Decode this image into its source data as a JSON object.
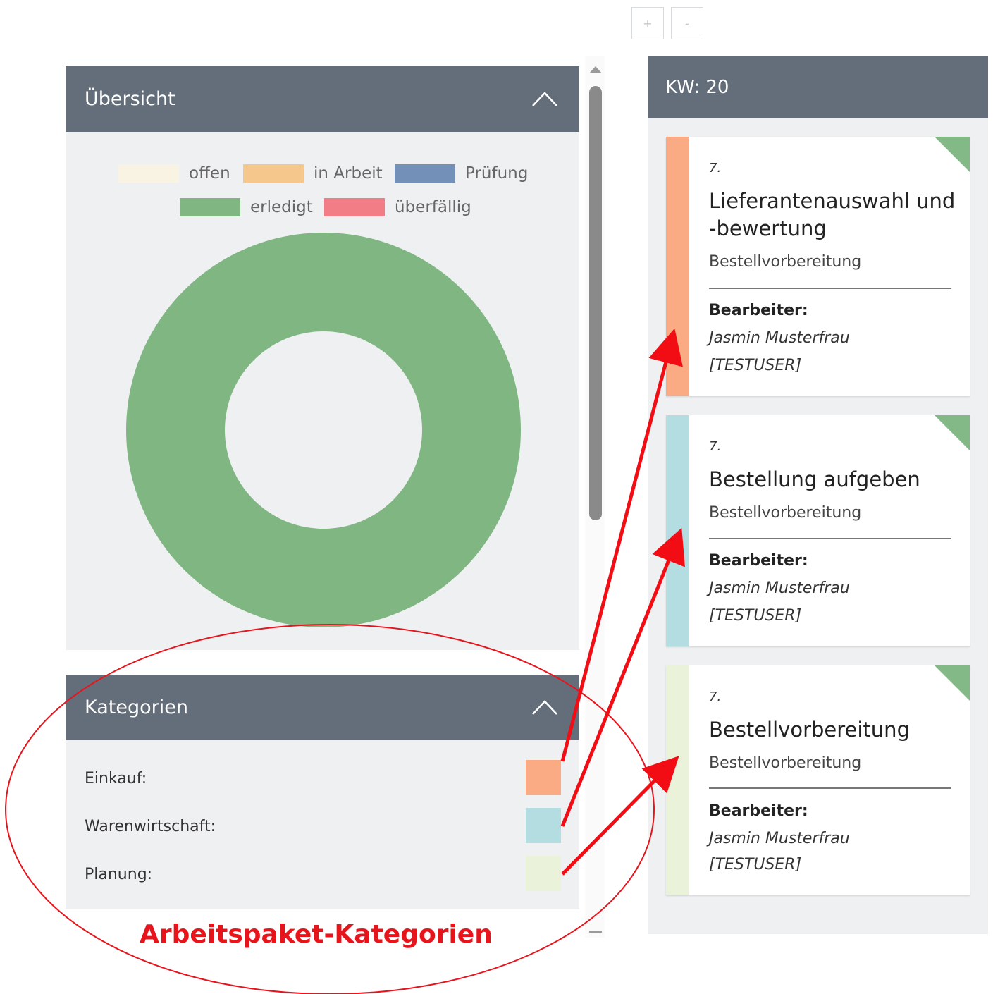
{
  "toolbar": {
    "zoom_in": "+",
    "zoom_out": "-"
  },
  "overview": {
    "title": "Übersicht",
    "legend": [
      {
        "label": "offen",
        "color": "#f8f3e2"
      },
      {
        "label": "in Arbeit",
        "color": "#f6c78d"
      },
      {
        "label": "Prüfung",
        "color": "#7390b8"
      },
      {
        "label": "erledigt",
        "color": "#7fb682"
      },
      {
        "label": "überfällig",
        "color": "#f27d86"
      }
    ],
    "chart_data": {
      "type": "pie",
      "donut": true,
      "categories": [
        "offen",
        "in Arbeit",
        "Prüfung",
        "erledigt",
        "überfällig"
      ],
      "values": [
        0,
        0,
        0,
        100,
        0
      ],
      "colors": [
        "#f8f3e2",
        "#f6c78d",
        "#7390b8",
        "#7fb682",
        "#f27d86"
      ],
      "legend_position": "top"
    }
  },
  "categories": {
    "title": "Kategorien",
    "items": [
      {
        "label": "Einkauf:",
        "color": "#fbab84"
      },
      {
        "label": "Warenwirtschaft:",
        "color": "#b3dde1"
      },
      {
        "label": "Planung:",
        "color": "#eaf3da"
      }
    ]
  },
  "week": {
    "title": "KW: 20",
    "cards": [
      {
        "number": "7.",
        "title": "Lieferantenauswahl und -bewertung",
        "subtitle": "Bestellvorbereitung",
        "assignee_label": "Bearbeiter:",
        "assignee_name": "Jasmin Musterfrau",
        "assignee_id": "[TESTUSER]",
        "stripe_color": "#fbab84"
      },
      {
        "number": "7.",
        "title": "Bestellung aufgeben",
        "subtitle": "Bestellvorbereitung",
        "assignee_label": "Bearbeiter:",
        "assignee_name": "Jasmin Musterfrau",
        "assignee_id": "[TESTUSER]",
        "stripe_color": "#b3dde1"
      },
      {
        "number": "7.",
        "title": "Bestellvorbereitung",
        "subtitle": "Bestellvorbereitung",
        "assignee_label": "Bearbeiter:",
        "assignee_name": "Jasmin Musterfrau",
        "assignee_id": "[TESTUSER]",
        "stripe_color": "#eaf3da"
      }
    ]
  },
  "annotation": {
    "text": "Arbeitspaket-Kategorien",
    "color": "#e8141c"
  }
}
